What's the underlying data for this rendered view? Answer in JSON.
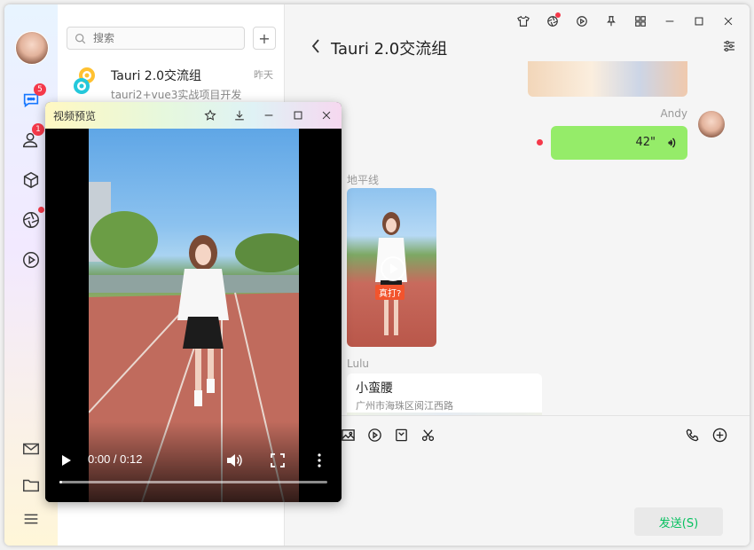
{
  "list": {
    "search_placeholder": "搜索",
    "add_label": "+",
    "chat": {
      "title": "Tauri 2.0交流组",
      "time": "昨天",
      "subtitle": "tauri2+vue3实战项目开发"
    }
  },
  "nav": {
    "message_badge": "5",
    "contacts_badge": "1"
  },
  "chat": {
    "title": "Tauri 2.0交流组",
    "sender_andy": "Andy",
    "voice_length": "42\"",
    "sender_horizon": "地平线",
    "video_label": "真打?",
    "sender_lulu": "Lulu",
    "location_title": "小蛮腰",
    "location_address": "广州市海珠区阅江西路",
    "send_label": "发送(S)"
  },
  "video_popup": {
    "title": "视频预览",
    "time": "0:00 / 0:12",
    "progress": 0.01
  },
  "colors": {
    "accent": "#07c160",
    "bubble_green": "#95ec69",
    "badge_red": "#f5394a"
  }
}
